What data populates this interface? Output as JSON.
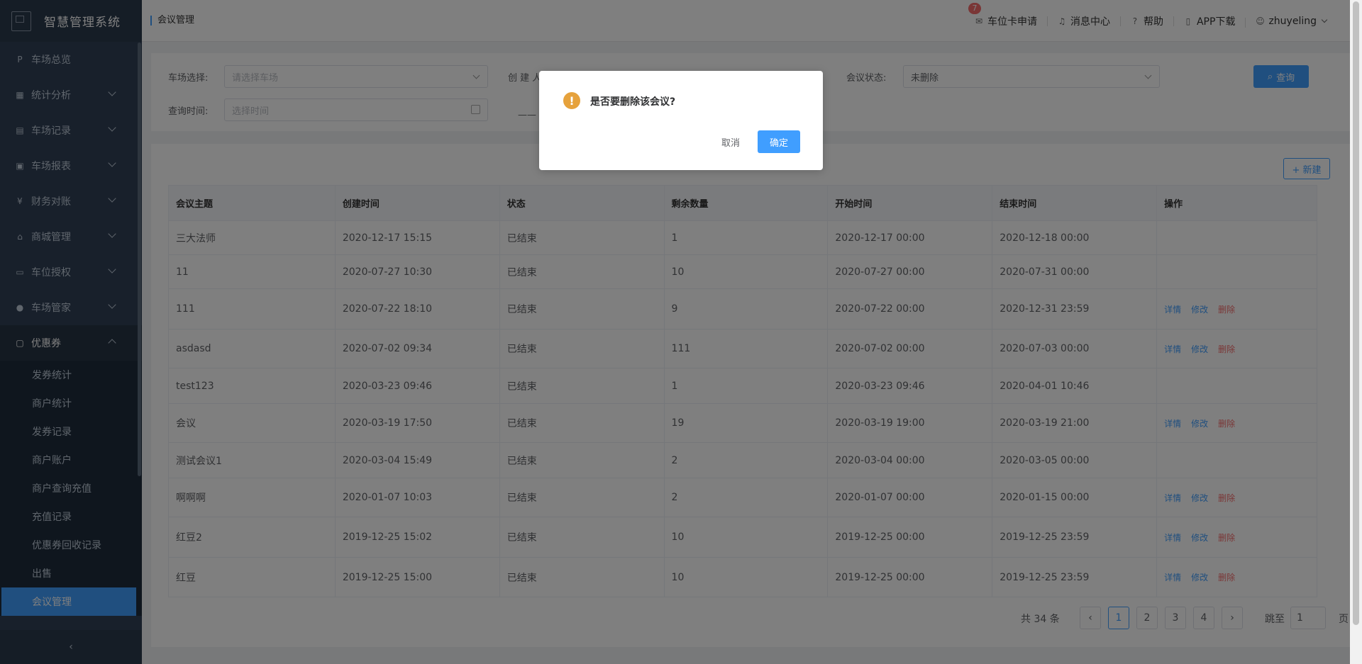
{
  "sidebar": {
    "title": "智慧管理系统",
    "items": [
      {
        "label": "车场总览",
        "icon": "parking-icon",
        "expandable": false
      },
      {
        "label": "统计分析",
        "icon": "chart-icon",
        "expandable": true
      },
      {
        "label": "车场记录",
        "icon": "record-icon",
        "expandable": true
      },
      {
        "label": "车场报表",
        "icon": "report-icon",
        "expandable": true
      },
      {
        "label": "财务对账",
        "icon": "finance-icon",
        "expandable": true
      },
      {
        "label": "商城管理",
        "icon": "shop-icon",
        "expandable": true
      },
      {
        "label": "车位授权",
        "icon": "car-icon",
        "expandable": true
      },
      {
        "label": "车场管家",
        "icon": "user-icon",
        "expandable": true
      },
      {
        "label": "优惠券",
        "icon": "coupon-icon",
        "expandable": true
      }
    ],
    "submenu": [
      "发券统计",
      "商户统计",
      "发券记录",
      "商户账户",
      "商户查询充值",
      "充值记录",
      "优惠券回收记录",
      "出售",
      "会议管理"
    ],
    "collapse_icon": "chevron-left-icon"
  },
  "header": {
    "breadcrumb": "会议管理",
    "badge_count": "7",
    "links": [
      "车位卡申请",
      "消息中心",
      "帮助",
      "APP下载"
    ],
    "username": "zhuyeling"
  },
  "filters": {
    "parking_label": "车场选择:",
    "parking_placeholder": "请选择车场",
    "creator_label": "创 建 人",
    "status_label": "会议状态:",
    "status_value": "未删除",
    "time_label": "查询时间:",
    "time_placeholder": "选择时间",
    "dash": "——",
    "query_label": "查询"
  },
  "table": {
    "new_label": "+ 新建",
    "columns": [
      "会议主题",
      "创建时间",
      "状态",
      "剩余数量",
      "开始时间",
      "结束时间",
      "操作"
    ],
    "ops": {
      "detail": "详情",
      "edit": "修改",
      "delete": "删除"
    },
    "rows": [
      {
        "topic": "三大法师",
        "created": "2020-12-17 15:15",
        "status": "已结束",
        "remain": "1",
        "start": "2020-12-17 00:00",
        "end": "2020-12-18 00:00",
        "has_ops": false
      },
      {
        "topic": "11",
        "created": "2020-07-27 10:30",
        "status": "已结束",
        "remain": "10",
        "start": "2020-07-27 00:00",
        "end": "2020-07-31 00:00",
        "has_ops": false
      },
      {
        "topic": "111",
        "created": "2020-07-22 18:10",
        "status": "已结束",
        "remain": "9",
        "start": "2020-07-22 00:00",
        "end": "2020-12-31 23:59",
        "has_ops": true
      },
      {
        "topic": "asdasd",
        "created": "2020-07-02 09:34",
        "status": "已结束",
        "remain": "111",
        "start": "2020-07-02 00:00",
        "end": "2020-07-03 00:00",
        "has_ops": true
      },
      {
        "topic": "test123",
        "created": "2020-03-23 09:46",
        "status": "已结束",
        "remain": "1",
        "start": "2020-03-23 09:46",
        "end": "2020-04-01 10:46",
        "has_ops": false
      },
      {
        "topic": "会议",
        "created": "2020-03-19 17:50",
        "status": "已结束",
        "remain": "19",
        "start": "2020-03-19 19:00",
        "end": "2020-03-19 21:00",
        "has_ops": true
      },
      {
        "topic": "测试会议1",
        "created": "2020-03-04 15:49",
        "status": "已结束",
        "remain": "2",
        "start": "2020-03-04 00:00",
        "end": "2020-03-05 00:00",
        "has_ops": false
      },
      {
        "topic": "啊啊啊",
        "created": "2020-01-07 10:03",
        "status": "已结束",
        "remain": "2",
        "start": "2020-01-07 00:00",
        "end": "2020-01-15 00:00",
        "has_ops": true
      },
      {
        "topic": "红豆2",
        "created": "2019-12-25 15:02",
        "status": "已结束",
        "remain": "10",
        "start": "2019-12-25 00:00",
        "end": "2019-12-25 23:59",
        "has_ops": true
      },
      {
        "topic": "红豆",
        "created": "2019-12-25 15:00",
        "status": "已结束",
        "remain": "10",
        "start": "2019-12-25 00:00",
        "end": "2019-12-25 23:59",
        "has_ops": true
      }
    ]
  },
  "pagination": {
    "total": "共 34 条",
    "prev": "‹",
    "pages": [
      "1",
      "2",
      "3",
      "4"
    ],
    "current": "1",
    "next": "›",
    "jump_label": "跳至",
    "jump_value": "1",
    "unit": "页"
  },
  "dialog": {
    "message": "是否要删除该会议?",
    "icon": "warning-icon",
    "cancel_label": "取消",
    "confirm_label": "确定"
  },
  "colors": {
    "primary": "#409eff",
    "sidebar_bg": "#304156",
    "danger": "#f56c6c",
    "warning": "#e6a23c"
  }
}
